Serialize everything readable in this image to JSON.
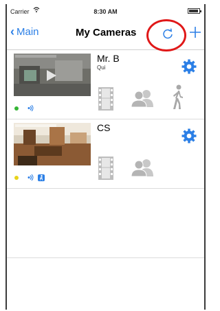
{
  "status_bar": {
    "carrier": "Carrier",
    "wifi_icon": "wifi-icon",
    "time": "8:30 AM",
    "battery_icon": "battery-icon"
  },
  "nav": {
    "back_label": "Main",
    "title": "My Cameras",
    "refresh_icon": "refresh-icon",
    "add_icon": "plus-icon",
    "accent_color": "#2b7fe6",
    "highlight_color": "#e01818"
  },
  "cameras": [
    {
      "name": "Mr. B",
      "subtitle": "Qui",
      "status_color": "#35b535",
      "icons": [
        "settings-icon",
        "film-icon",
        "people-icon",
        "walking-person-icon"
      ]
    },
    {
      "name": "CS",
      "subtitle": "",
      "status_color": "#e8d31a",
      "icons": [
        "settings-icon",
        "film-icon",
        "people-icon"
      ]
    }
  ]
}
